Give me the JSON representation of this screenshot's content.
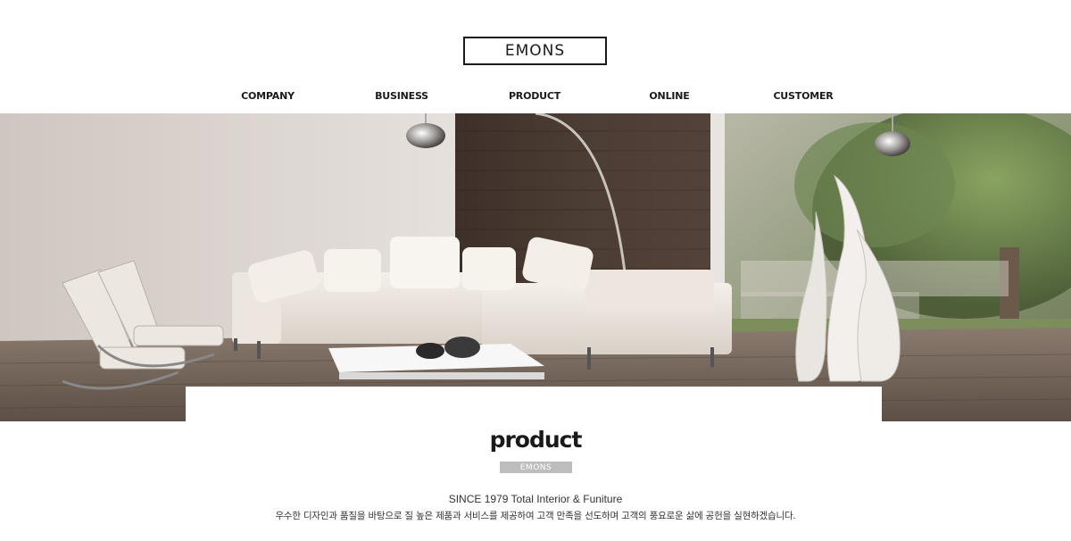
{
  "header": {
    "logo_text": "EMONS"
  },
  "nav": {
    "items": [
      {
        "label": "COMPANY"
      },
      {
        "label": "BUSINESS"
      },
      {
        "label": "PRODUCT"
      },
      {
        "label": "ONLINE"
      },
      {
        "label": "CUSTOMER"
      }
    ]
  },
  "hero": {
    "image_alt": "living-room-sofa-interior"
  },
  "section": {
    "title": "product",
    "badge": "EMONS",
    "since_line": "SINCE 1979 Total Interior & Funiture",
    "description": "우수한 디자인과 품질을 바탕으로 질 높은 제품과 서비스를 제공하여 고객 만족을 선도하며 고객의 풍요로운 삶에 공헌을 실현하겠습니다."
  },
  "colors": {
    "text_dark": "#1a1a1a",
    "badge_bg": "#bdbdbd",
    "background": "#ffffff"
  }
}
